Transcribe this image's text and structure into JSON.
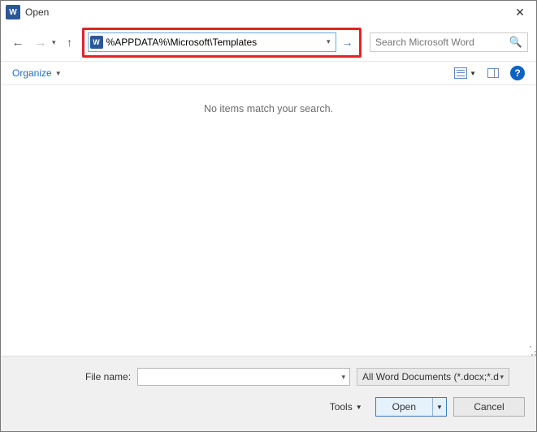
{
  "titlebar": {
    "title": "Open"
  },
  "nav": {
    "address": "%APPDATA%\\Microsoft\\Templates",
    "search_placeholder": "Search Microsoft Word"
  },
  "toolbar": {
    "organize": "Organize"
  },
  "content": {
    "empty_message": "No items match your search."
  },
  "footer": {
    "filename_label": "File name:",
    "filename_value": "",
    "filter_label": "All Word Documents (*.docx;*.d",
    "tools_label": "Tools",
    "open_label": "Open",
    "cancel_label": "Cancel"
  }
}
